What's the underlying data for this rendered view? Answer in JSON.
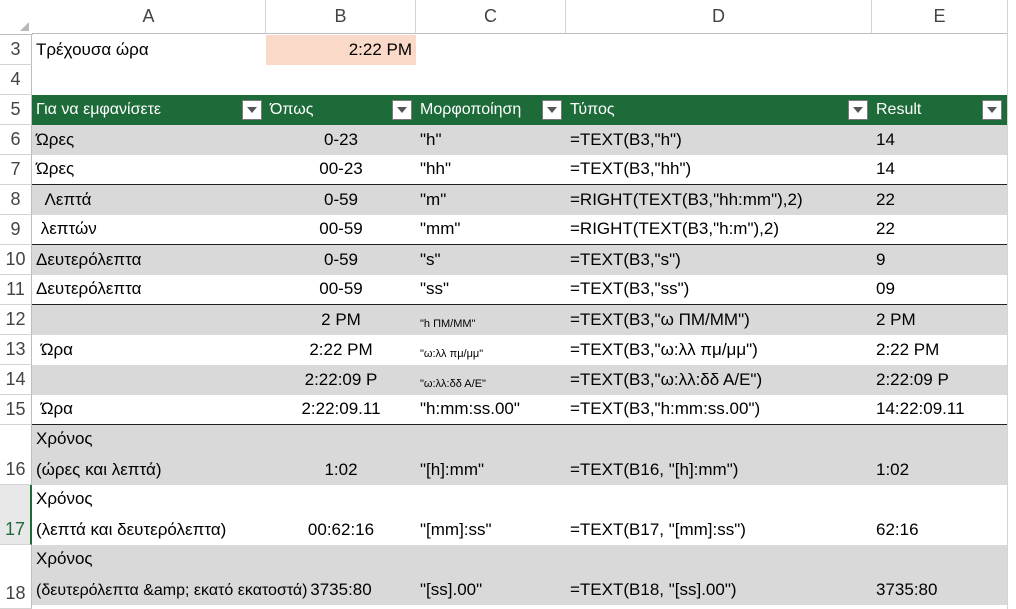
{
  "columns": [
    "A",
    "B",
    "C",
    "D",
    "E"
  ],
  "row3": {
    "num": "3",
    "label": "Τρέχουσα ώρα",
    "value": "2:22 PM"
  },
  "row4": {
    "num": "4"
  },
  "header": {
    "num": "5",
    "col_a": "Για να εμφανίσετε",
    "col_b": "Όπως",
    "col_c": "Μορφοποίηση",
    "col_d": "Τύπος",
    "col_e": "Result"
  },
  "rows": [
    {
      "num": "6",
      "a": "Ώρες",
      "b": "0-23",
      "c": "\"h\"",
      "d": "=TEXT(B3,\"h\")",
      "e": "14"
    },
    {
      "num": "7",
      "a": "Ώρες",
      "b": "00-23",
      "c": "\"hh\"",
      "d": "=TEXT(B3,\"hh\")",
      "e": "14"
    },
    {
      "num": "8",
      "a": "  Λεπτά",
      "b": "0-59",
      "c": "\"m\"",
      "d": "=RIGHT(TEXT(B3,\"hh:mm\"),2)",
      "e": "22"
    },
    {
      "num": "9",
      "a": " λεπτών",
      "b": "00-59",
      "c": "\"mm\"",
      "d": "=RIGHT(TEXT(B3,\"h:m\"),2)",
      "e": "22"
    },
    {
      "num": "10",
      "a": "Δευτερόλεπτα",
      "b": "0-59",
      "c": "\"s\"",
      "d": "=TEXT(B3,\"s\")",
      "e": "9"
    },
    {
      "num": "11",
      "a": "Δευτερόλεπτα",
      "b": "00-59",
      "c": "\"ss\"",
      "d": "=TEXT(B3,\"ss\")",
      "e": "09"
    },
    {
      "num": "12",
      "a": "",
      "b": "2 PM",
      "c": "\"h ΠΜ/ΜΜ\"",
      "d": "=TEXT(B3,\"ω ΠΜ/ΜΜ\")",
      "e": "2 PM"
    },
    {
      "num": "13",
      "a": " Ώρα",
      "b": "2:22 PM",
      "c": "\"ω:λλ πμ/μμ\"",
      "d": "=TEXT(B3,\"ω:λλ πμ/μμ\")",
      "e": "2:22 PM"
    },
    {
      "num": "14",
      "a": "",
      "b": "2:22:09 P",
      "c": "\"ω:λλ:δδ Α/Ε\"",
      "d": "=TEXT(B3,\"ω:λλ:δδ Α/Ε\")",
      "e": "2:22:09 P"
    },
    {
      "num": "15",
      "a": " Ώρα",
      "b": "2:22:09.11",
      "c": "\"h:mm:ss.00\"",
      "d": "=TEXT(B3,\"h:mm:ss.00\")",
      "e": "14:22:09.11"
    }
  ],
  "tall_rows": [
    {
      "num": "16",
      "a1": "Χρόνος",
      "a2": "(ώρες και λεπτά)",
      "b": "1:02",
      "c": "\"[h]:mm\"",
      "d": "=TEXT(B16, \"[h]:mm\")",
      "e": "1:02"
    },
    {
      "num": "17",
      "a1": "Χρόνος",
      "a2": "(λεπτά και δευτερόλεπτα)",
      "b": "00:62:16",
      "c": "\"[mm]:ss\"",
      "d": "=TEXT(B17, \"[mm]:ss\")",
      "e": "62:16"
    },
    {
      "num": "18",
      "a1": "Χρόνος",
      "a2": "(δευτερόλεπτα &amp; εκατό εκατοστά)",
      "b": "3735:80",
      "c": "\"[ss].00\"",
      "d": "=TEXT(B18, \"[ss].00\")",
      "e": "3735:80"
    }
  ],
  "colors": {
    "header_bg": "#1e6b3a",
    "band_gray": "#d9d9d9",
    "highlight": "#fbd9c8"
  }
}
